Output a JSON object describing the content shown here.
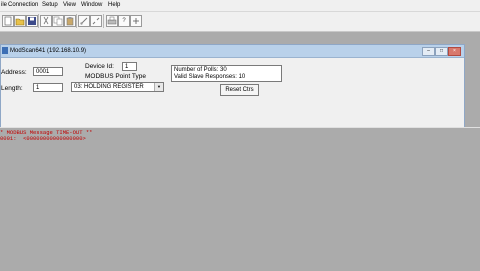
{
  "menu": [
    "ile",
    "Connection",
    "Setup",
    "View",
    "Window",
    "Help"
  ],
  "toolbar": {
    "icons": [
      "new-icon",
      "open-icon",
      "save-icon",
      "cut-icon",
      "copy-icon",
      "paste-icon",
      "connect-icon",
      "disconnect-icon",
      "print-icon",
      "help-icon",
      "about-icon"
    ]
  },
  "window": {
    "title": "ModScan641 (192.168.10.9)"
  },
  "form": {
    "address_label": "Address:",
    "address_value": "0001",
    "length_label": "Length:",
    "length_value": "1",
    "device_id_label": "Device Id:",
    "device_id_value": "1",
    "point_type_label": "MODBUS Point Type",
    "point_type_value": "03: HOLDING REGISTER",
    "polls_text": "Number of Polls: 30",
    "responses_text": "Valid Slave Responses: 10",
    "reset_label": "Reset Ctrs"
  },
  "log": {
    "line1": "* MODBUS Message TIME-OUT **",
    "line2": "0001:  <00000000000000000>",
    "line1_color": "#c00000",
    "line2_color": "#c00000"
  }
}
